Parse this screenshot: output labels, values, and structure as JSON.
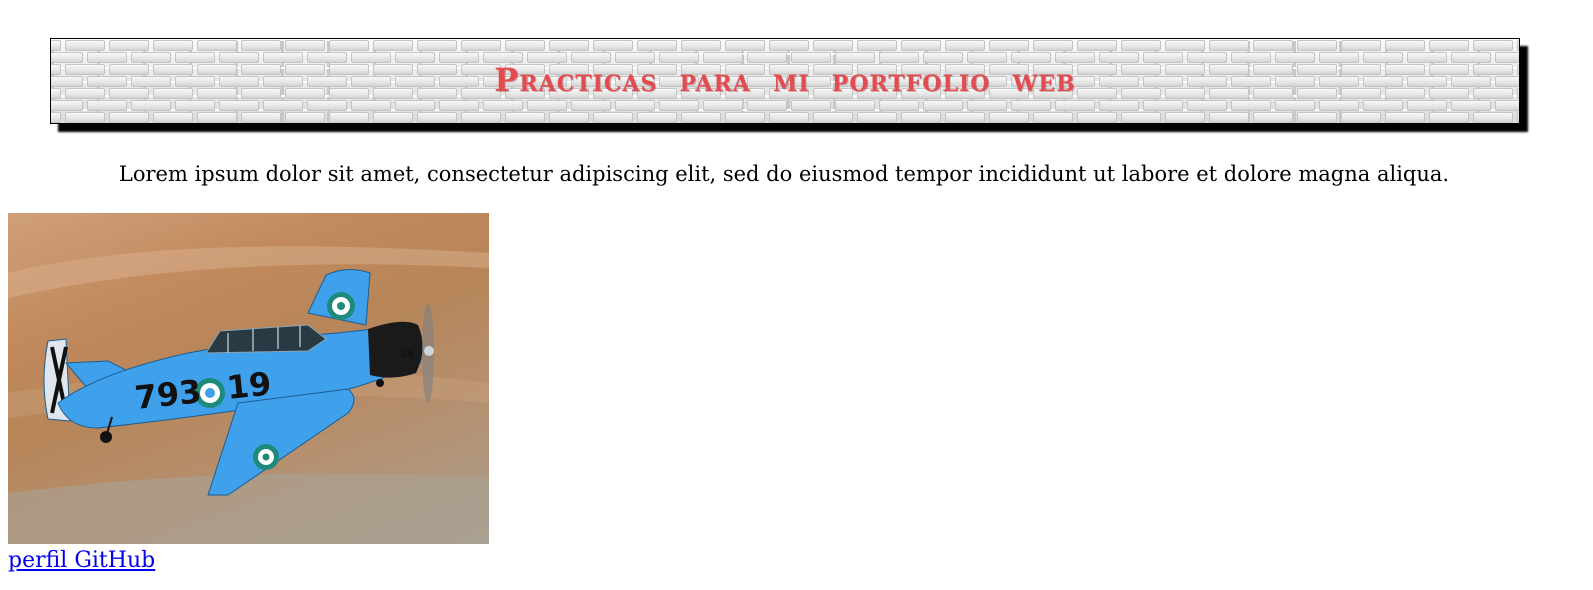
{
  "header": {
    "title": "Practicas para mi portfolio web"
  },
  "main": {
    "intro_text": "Lorem ipsum dolor sit amet, consectetur adipiscing elit, sed do eiusmod tempor incididunt ut labore et dolore magna aliqua.",
    "image": {
      "aircraft_number": "793",
      "aircraft_number_right": "19",
      "nose_number": "19"
    },
    "link_label": "perfil GitHub"
  },
  "colors": {
    "title_red": "#e24b50",
    "link_blue": "#0000ee",
    "plane_blue": "#3fa0ec"
  }
}
